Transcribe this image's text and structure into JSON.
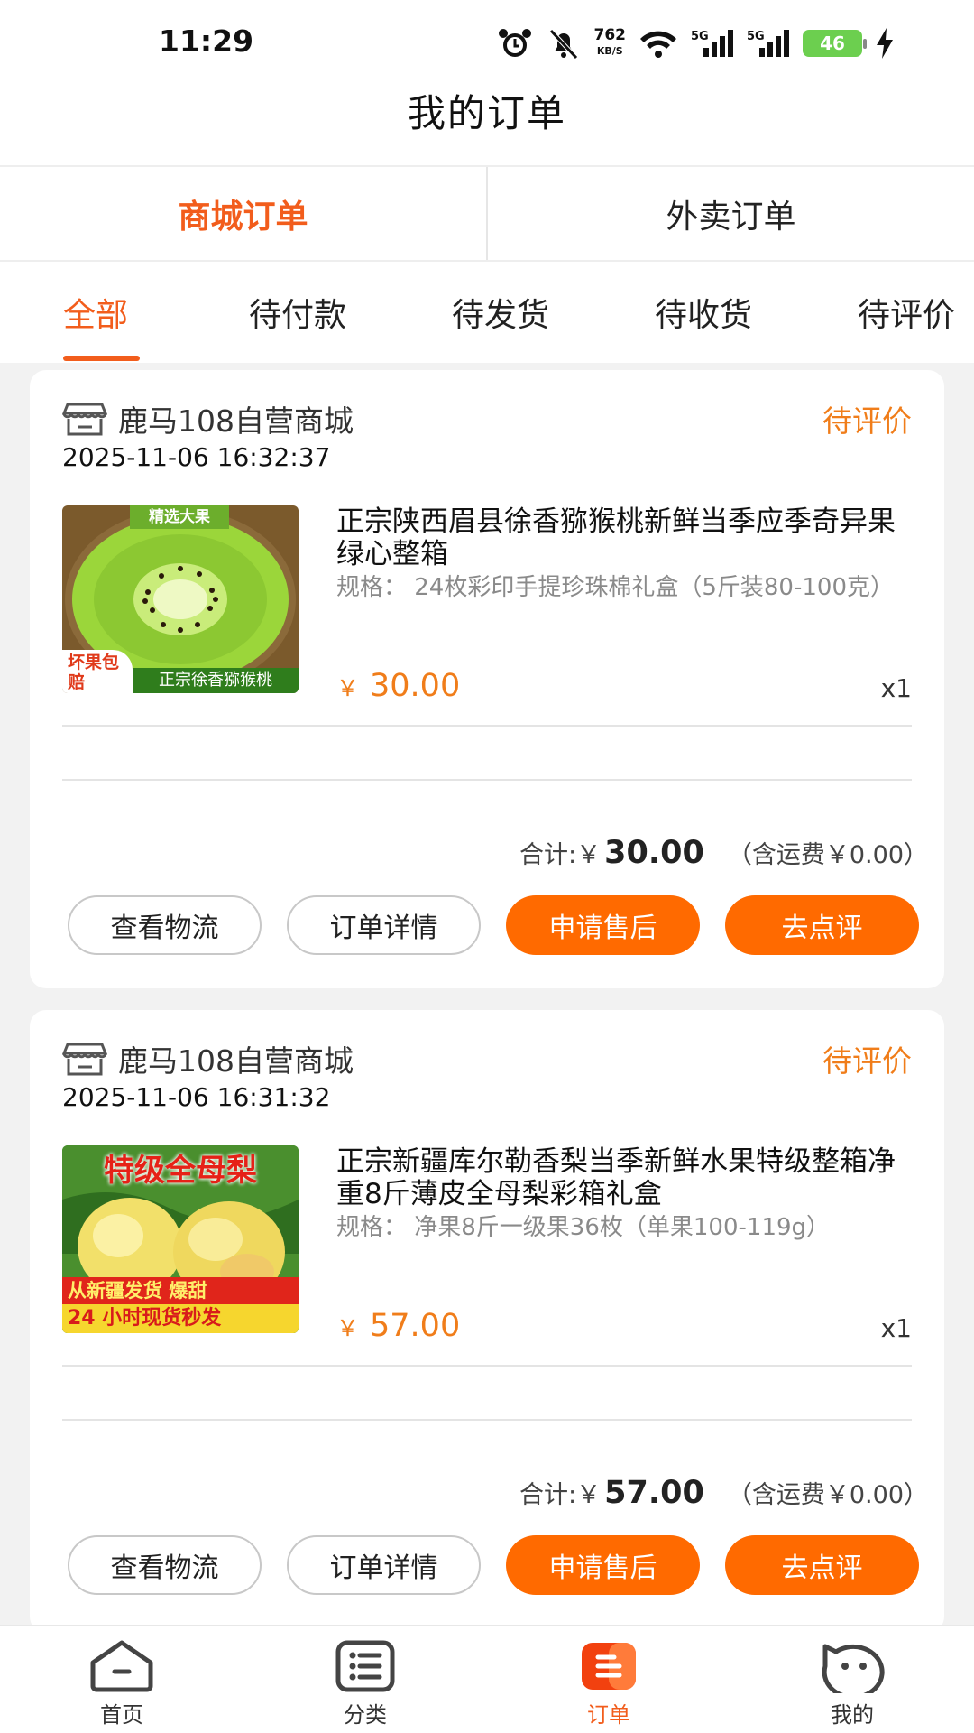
{
  "status_bar": {
    "time": "11:29",
    "net_speed": "762",
    "net_unit": "KB/S",
    "signal1": "5G",
    "signal2": "5G",
    "battery": "46"
  },
  "header": {
    "title": "我的订单"
  },
  "order_types": [
    {
      "label": "商城订单",
      "active": true
    },
    {
      "label": "外卖订单",
      "active": false
    }
  ],
  "filters": [
    {
      "label": "全部",
      "active": true
    },
    {
      "label": "待付款"
    },
    {
      "label": "待发货"
    },
    {
      "label": "待收货"
    },
    {
      "label": "待评价"
    }
  ],
  "orders": [
    {
      "shop": "鹿马108自营商城",
      "status": "待评价",
      "time": "2025-11-06 16:32:37",
      "product": {
        "title": "正宗陕西眉县徐香猕猴桃新鲜当季应季奇异果绿心整箱",
        "spec": "规格：  24枚彩印手提珍珠棉礼盒（5斤装80-100克）",
        "price": "30.00",
        "qty": "x1",
        "image": {
          "badge_top": "精选大果",
          "badge_left": "坏果包赔",
          "badge_bottom": "正宗徐香猕猴桃"
        }
      },
      "total_label": "合计:",
      "total_currency": "￥",
      "total_value": "30.00",
      "shipping": "（含运费￥0.00）",
      "buttons": [
        "查看物流",
        "订单详情",
        "申请售后",
        "去点评"
      ]
    },
    {
      "shop": "鹿马108自营商城",
      "status": "待评价",
      "time": "2025-11-06 16:31:32",
      "product": {
        "title": "正宗新疆库尔勒香梨当季新鲜水果特级整箱净重8斤薄皮全母梨彩箱礼盒",
        "spec": "规格：  净果8斤一级果36枚（单果100-119g）",
        "price": "57.00",
        "qty": "x1",
        "image": {
          "headline": "特级全母梨",
          "band1": "从新疆发货  爆甜",
          "band2": "24 小时现货秒发"
        }
      },
      "total_label": "合计:",
      "total_currency": "￥",
      "total_value": "57.00",
      "shipping": "（含运费￥0.00）",
      "buttons": [
        "查看物流",
        "订单详情",
        "申请售后",
        "去点评"
      ]
    }
  ],
  "price_currency": "￥",
  "colors": {
    "accent": "#f25d1c",
    "status": "#f07d1a",
    "primary_button": "#ff6a00"
  },
  "bottom_nav": [
    {
      "label": "首页",
      "icon": "home-icon"
    },
    {
      "label": "分类",
      "icon": "category-list-icon"
    },
    {
      "label": "订单",
      "icon": "order-icon",
      "active": true
    },
    {
      "label": "我的",
      "icon": "profile-icon"
    }
  ]
}
